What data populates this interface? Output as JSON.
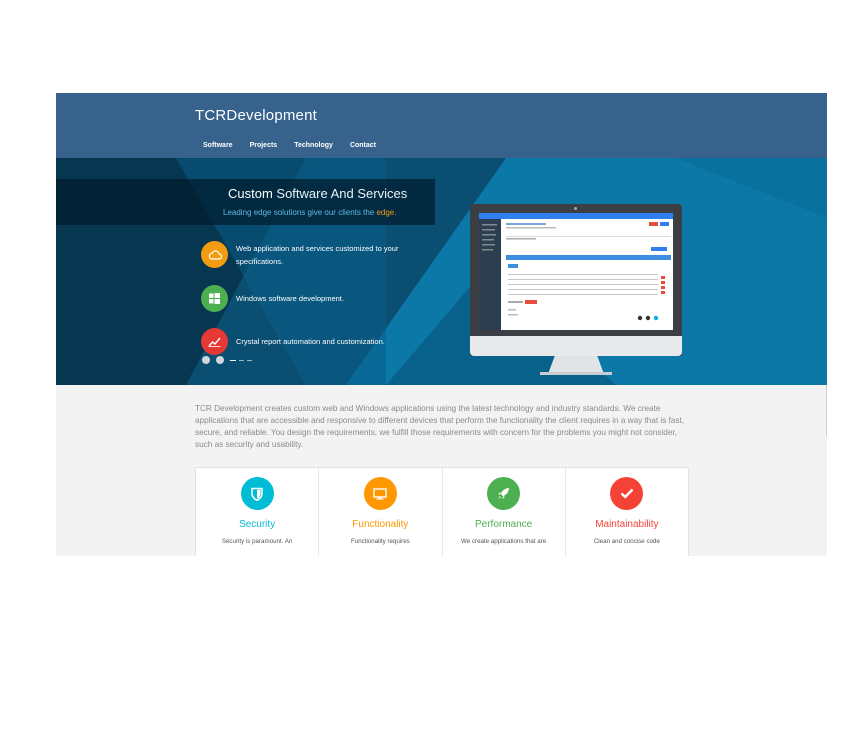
{
  "site": {
    "brand": "TCRDevelopment",
    "nav": [
      {
        "label": "Software"
      },
      {
        "label": "Projects"
      },
      {
        "label": "Technology"
      },
      {
        "label": "Contact"
      }
    ]
  },
  "hero": {
    "title_bold": "Custom",
    "title_rest": " Software And Services",
    "subtitle_pre": "Leading edge solutions give our clients the ",
    "subtitle_accent": "edge",
    "subtitle_post": ".",
    "features": [
      {
        "text": "Web application and services customized to your specifications.",
        "icon": "cloud-icon",
        "color": "#f39c12"
      },
      {
        "text": "Windows software development.",
        "icon": "windows-icon",
        "color": "#4caf50"
      },
      {
        "text": "Crystal report automation and customization.",
        "icon": "chart-icon",
        "color": "#e53935"
      }
    ]
  },
  "intro": "TCR Development creates custom web and Windows applications using the latest technology and industry standards. We create applications that are accessible and responsive to different devices that perform the functionality the client requires in a way that is fast, secure, and reliable. You design the requirements, we fulfill those requirements with concern for the problems you might not consider, such as security and usability.",
  "cards": [
    {
      "title": "Security",
      "desc": "Security is paramount. An",
      "color": "#00bcd4",
      "icon": "shield-icon"
    },
    {
      "title": "Functionality",
      "desc": "Functionality requires",
      "color": "#ff9800",
      "icon": "monitor-icon"
    },
    {
      "title": "Performance",
      "desc": "We create applications that are",
      "color": "#4caf50",
      "icon": "rocket-icon"
    },
    {
      "title": "Maintainability",
      "desc": "Clean and concise code",
      "color": "#f44336",
      "icon": "check-icon"
    }
  ],
  "colors": {
    "header": "#36628c",
    "hero": "#0b76a6",
    "accent": "#f39c12"
  }
}
